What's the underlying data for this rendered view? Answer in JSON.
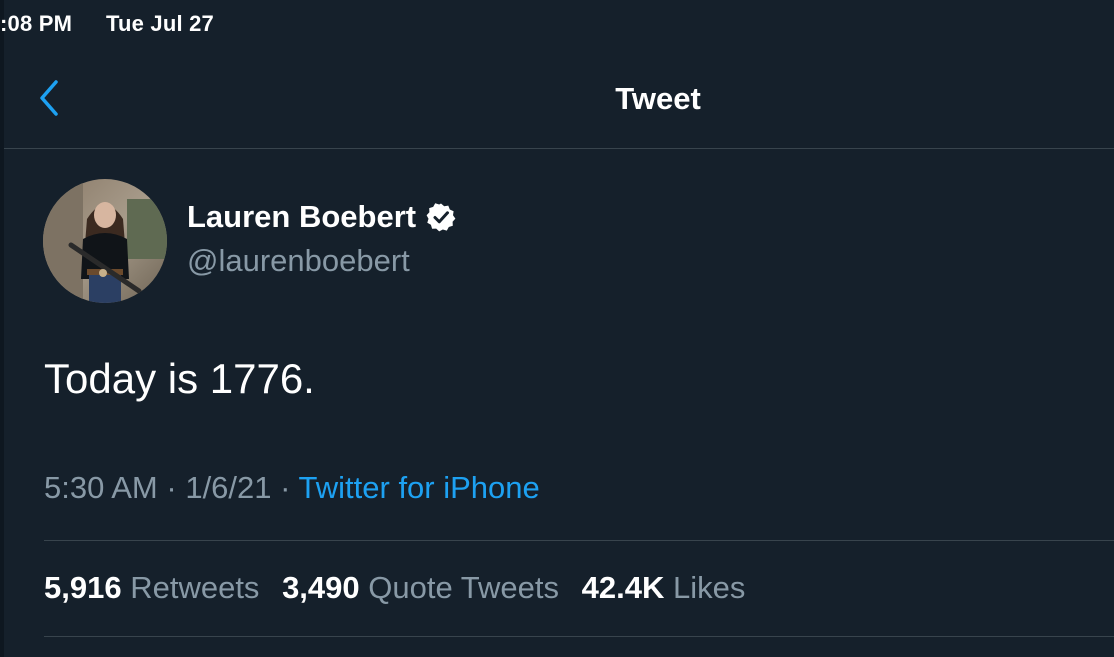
{
  "status_bar": {
    "time": ":08 PM",
    "date": "Tue Jul 27"
  },
  "nav": {
    "back_icon": "chevron-left-icon",
    "title": "Tweet"
  },
  "tweet": {
    "author": {
      "name": "Lauren Boebert",
      "handle": "@laurenboebert",
      "verified_icon": "verified-badge-icon"
    },
    "text": "Today is 1776.",
    "time": "5:30 AM",
    "date": "1/6/21",
    "separator": "·",
    "source": "Twitter for iPhone",
    "stats": {
      "retweets_count": "5,916",
      "retweets_label": "Retweets",
      "quotes_count": "3,490",
      "quotes_label": "Quote Tweets",
      "likes_count": "42.4K",
      "likes_label": "Likes"
    }
  },
  "colors": {
    "background": "#15202b",
    "accent": "#1da1f2",
    "secondary_text": "#8899a6",
    "divider": "#38444d"
  }
}
